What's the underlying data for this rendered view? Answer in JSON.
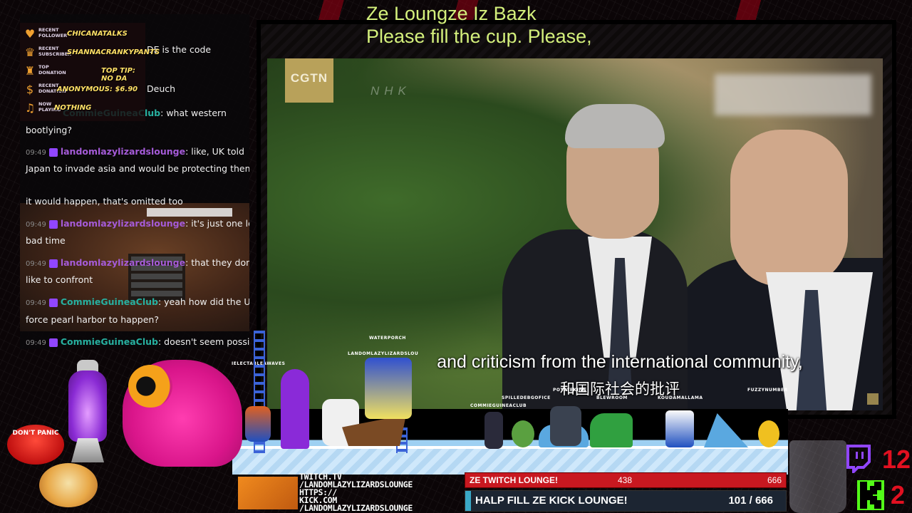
{
  "header": {
    "line1": "Ze Loungze Iz Bazk",
    "line2": "Please fill the cup. Please,"
  },
  "video": {
    "channel_logo": "CGTN",
    "watermark": "NHK",
    "subtitle_en": "and criticism from the international community,",
    "subtitle_zh": "和国际社会的批评"
  },
  "events": [
    {
      "icon": "heart-icon",
      "tag": "RECENT\nFOLLOWER",
      "value": "CHICANATALKS"
    },
    {
      "icon": "crown-icon",
      "tag": "RECENT\nSUBSCRIBER",
      "value": "SHANNACRANKYPANTS"
    },
    {
      "icon": "trophy-icon",
      "tag": "TOP\nDONATION",
      "value": "TOP TIP: NO DA"
    },
    {
      "icon": "moneybag-icon",
      "tag": "RECENT\nDONATION",
      "value": "ANONYMOUS: $6.90"
    },
    {
      "icon": "music-note-icon",
      "tag": "NOW\nPLAYING",
      "value": "NOTHING"
    }
  ],
  "chat": {
    "fragments": [
      {
        "time": "",
        "user": "",
        "text": "DE is the code"
      },
      {
        "time": "",
        "user": "",
        "text": "Deuch"
      },
      {
        "time": "",
        "user": "CommieGuineaClub",
        "text": "what western"
      },
      {
        "time": "",
        "user": "",
        "text": "bootlying?"
      }
    ],
    "messages": [
      {
        "time": "09:49",
        "user": "landomlazylizardslounge",
        "color": "purple",
        "text": "like, UK told"
      },
      {
        "time": "",
        "user": "",
        "color": "",
        "text": "Japan to invade asia and would be protecting them"
      },
      {
        "time": "",
        "user": "",
        "color": "",
        "text": "it would happen, that's omitted too"
      },
      {
        "time": "09:49",
        "user": "landomlazylizardslounge",
        "color": "purple",
        "text": "it's just one long"
      },
      {
        "time": "",
        "user": "",
        "color": "",
        "text": "bad time"
      },
      {
        "time": "09:49",
        "user": "landomlazylizardslounge",
        "color": "purple",
        "text": "that they don't"
      },
      {
        "time": "",
        "user": "",
        "color": "",
        "text": "like to confront"
      },
      {
        "time": "09:49",
        "user": "CommieGuineaClub",
        "color": "teal",
        "text": "yeah how did the US"
      },
      {
        "time": "",
        "user": "",
        "color": "",
        "text": "force pearl harbor to happen?"
      },
      {
        "time": "09:49",
        "user": "CommieGuineaClub",
        "color": "teal",
        "text": "doesn't seem possible"
      }
    ]
  },
  "stage_names": [
    {
      "name": "WATERPORCH"
    },
    {
      "name": "LANDOMLAZYLIZARDSLOU"
    },
    {
      "name": "IELECTABLEAWAVES"
    },
    {
      "name": "COMMIEGUINEACLUB"
    },
    {
      "name": "SPILLEDEBGOFICE"
    },
    {
      "name": "POTATEKING"
    },
    {
      "name": "BLEWROOM"
    },
    {
      "name": "KOUDAMALLAMA"
    },
    {
      "name": "FUZZYNUMBER"
    }
  ],
  "panic_button": "DON'T PANIC",
  "links": {
    "line1": "TWITCH.TV",
    "line2": "/LANDOMLAZYLIZARDSLOUNGE",
    "line3": "HTTPS://",
    "line4": "KICK.COM",
    "line5": "/LANDOMLAZYLIZARDSLOUNGE"
  },
  "goals": {
    "twitch_label": "ZE TWITCH LOUNGE!",
    "twitch_current": "438",
    "twitch_target": "666",
    "kick_label": "HALP FILL ZE KICK LOUNGE!",
    "kick_progress": "101 / 666",
    "kick_fraction": 0.152
  },
  "platform_counts": {
    "twitch": "12",
    "kick": "2"
  },
  "colors": {
    "title": "#d4f07c",
    "twitch": "#9146ff",
    "kick": "#53fc18",
    "count": "#e11020"
  }
}
